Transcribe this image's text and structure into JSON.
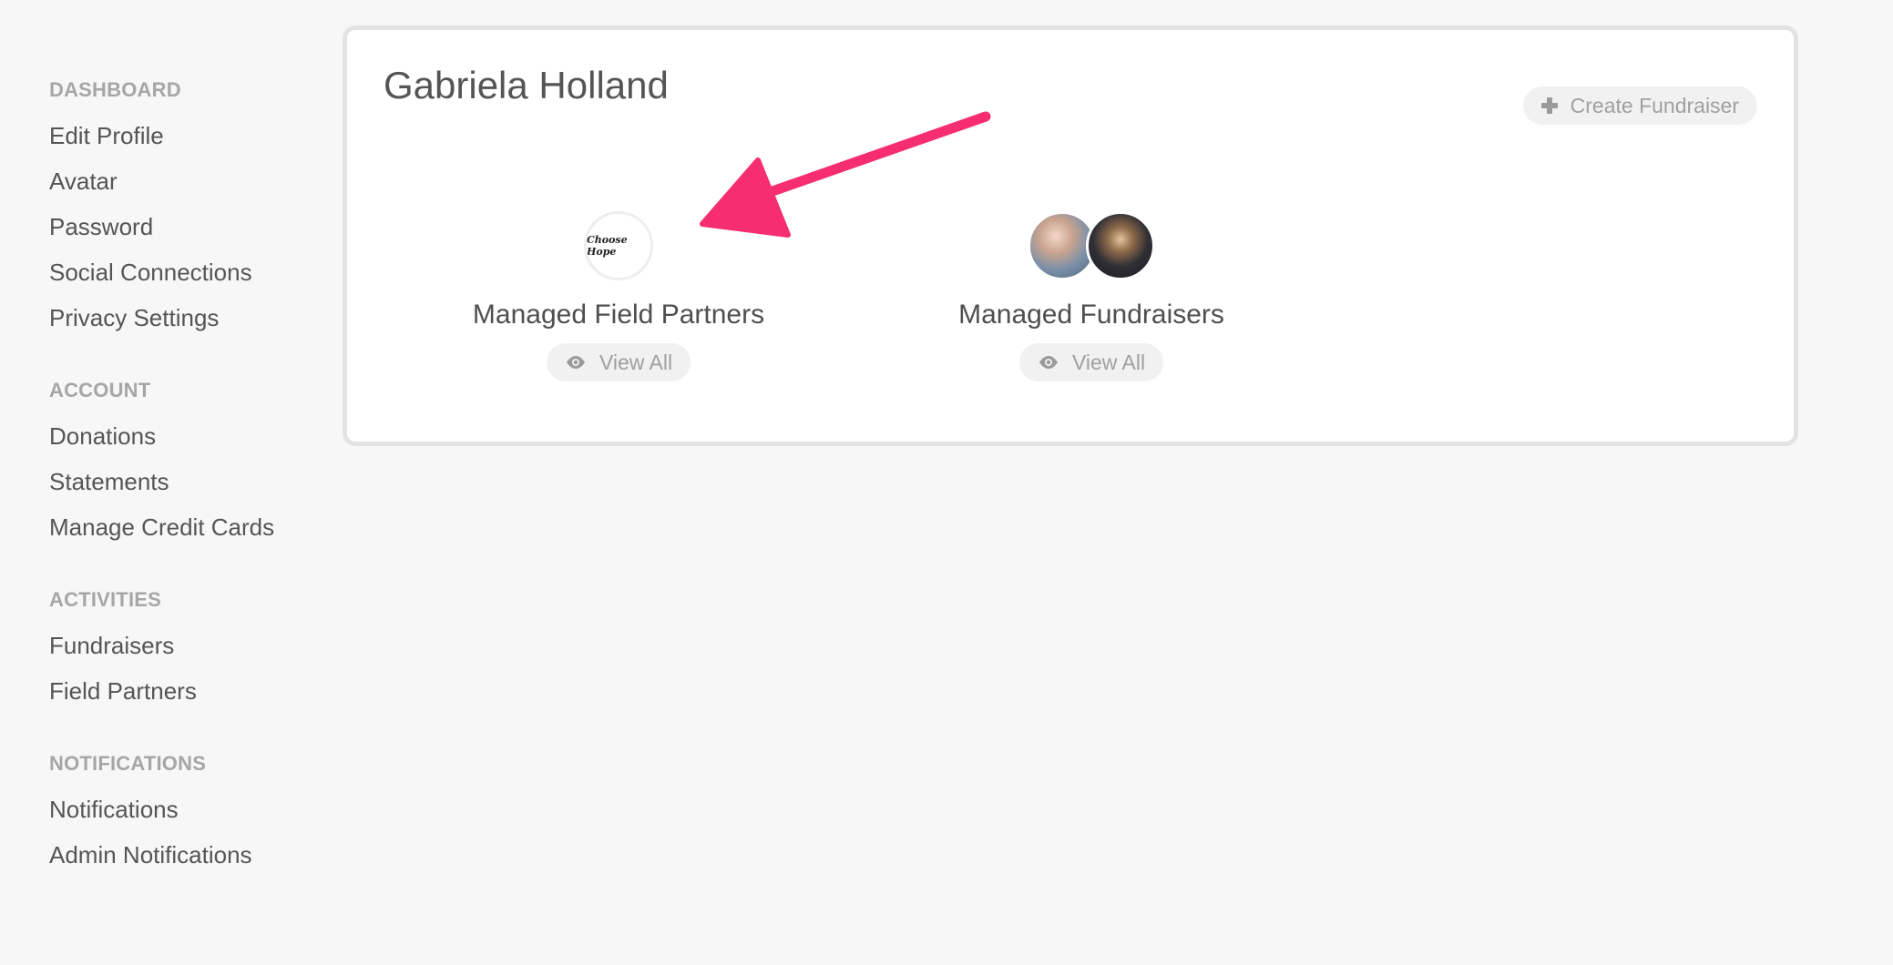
{
  "sidebar": {
    "sections": [
      {
        "heading": "DASHBOARD",
        "items": [
          "Edit Profile",
          "Avatar",
          "Password",
          "Social Connections",
          "Privacy Settings"
        ]
      },
      {
        "heading": "ACCOUNT",
        "items": [
          "Donations",
          "Statements",
          "Manage Credit Cards"
        ]
      },
      {
        "heading": "ACTIVITIES",
        "items": [
          "Fundraisers",
          "Field Partners"
        ]
      },
      {
        "heading": "NOTIFICATIONS",
        "items": [
          "Notifications",
          "Admin Notifications"
        ]
      }
    ]
  },
  "profile": {
    "name": "Gabriela Holland",
    "create_button_label": "Create Fundraiser"
  },
  "tiles": {
    "partners": {
      "label": "Managed Field Partners",
      "view_label": "View All",
      "logo_text": "Choose Hope"
    },
    "fundraisers": {
      "label": "Managed Fundraisers",
      "view_label": "View All"
    }
  },
  "icons": {
    "create": "plus-icon",
    "view": "eye-icon"
  },
  "colors": {
    "annotation_arrow": "#f72d72",
    "card_border": "#e3e3e3",
    "muted_button_bg": "#f1f1f1"
  }
}
